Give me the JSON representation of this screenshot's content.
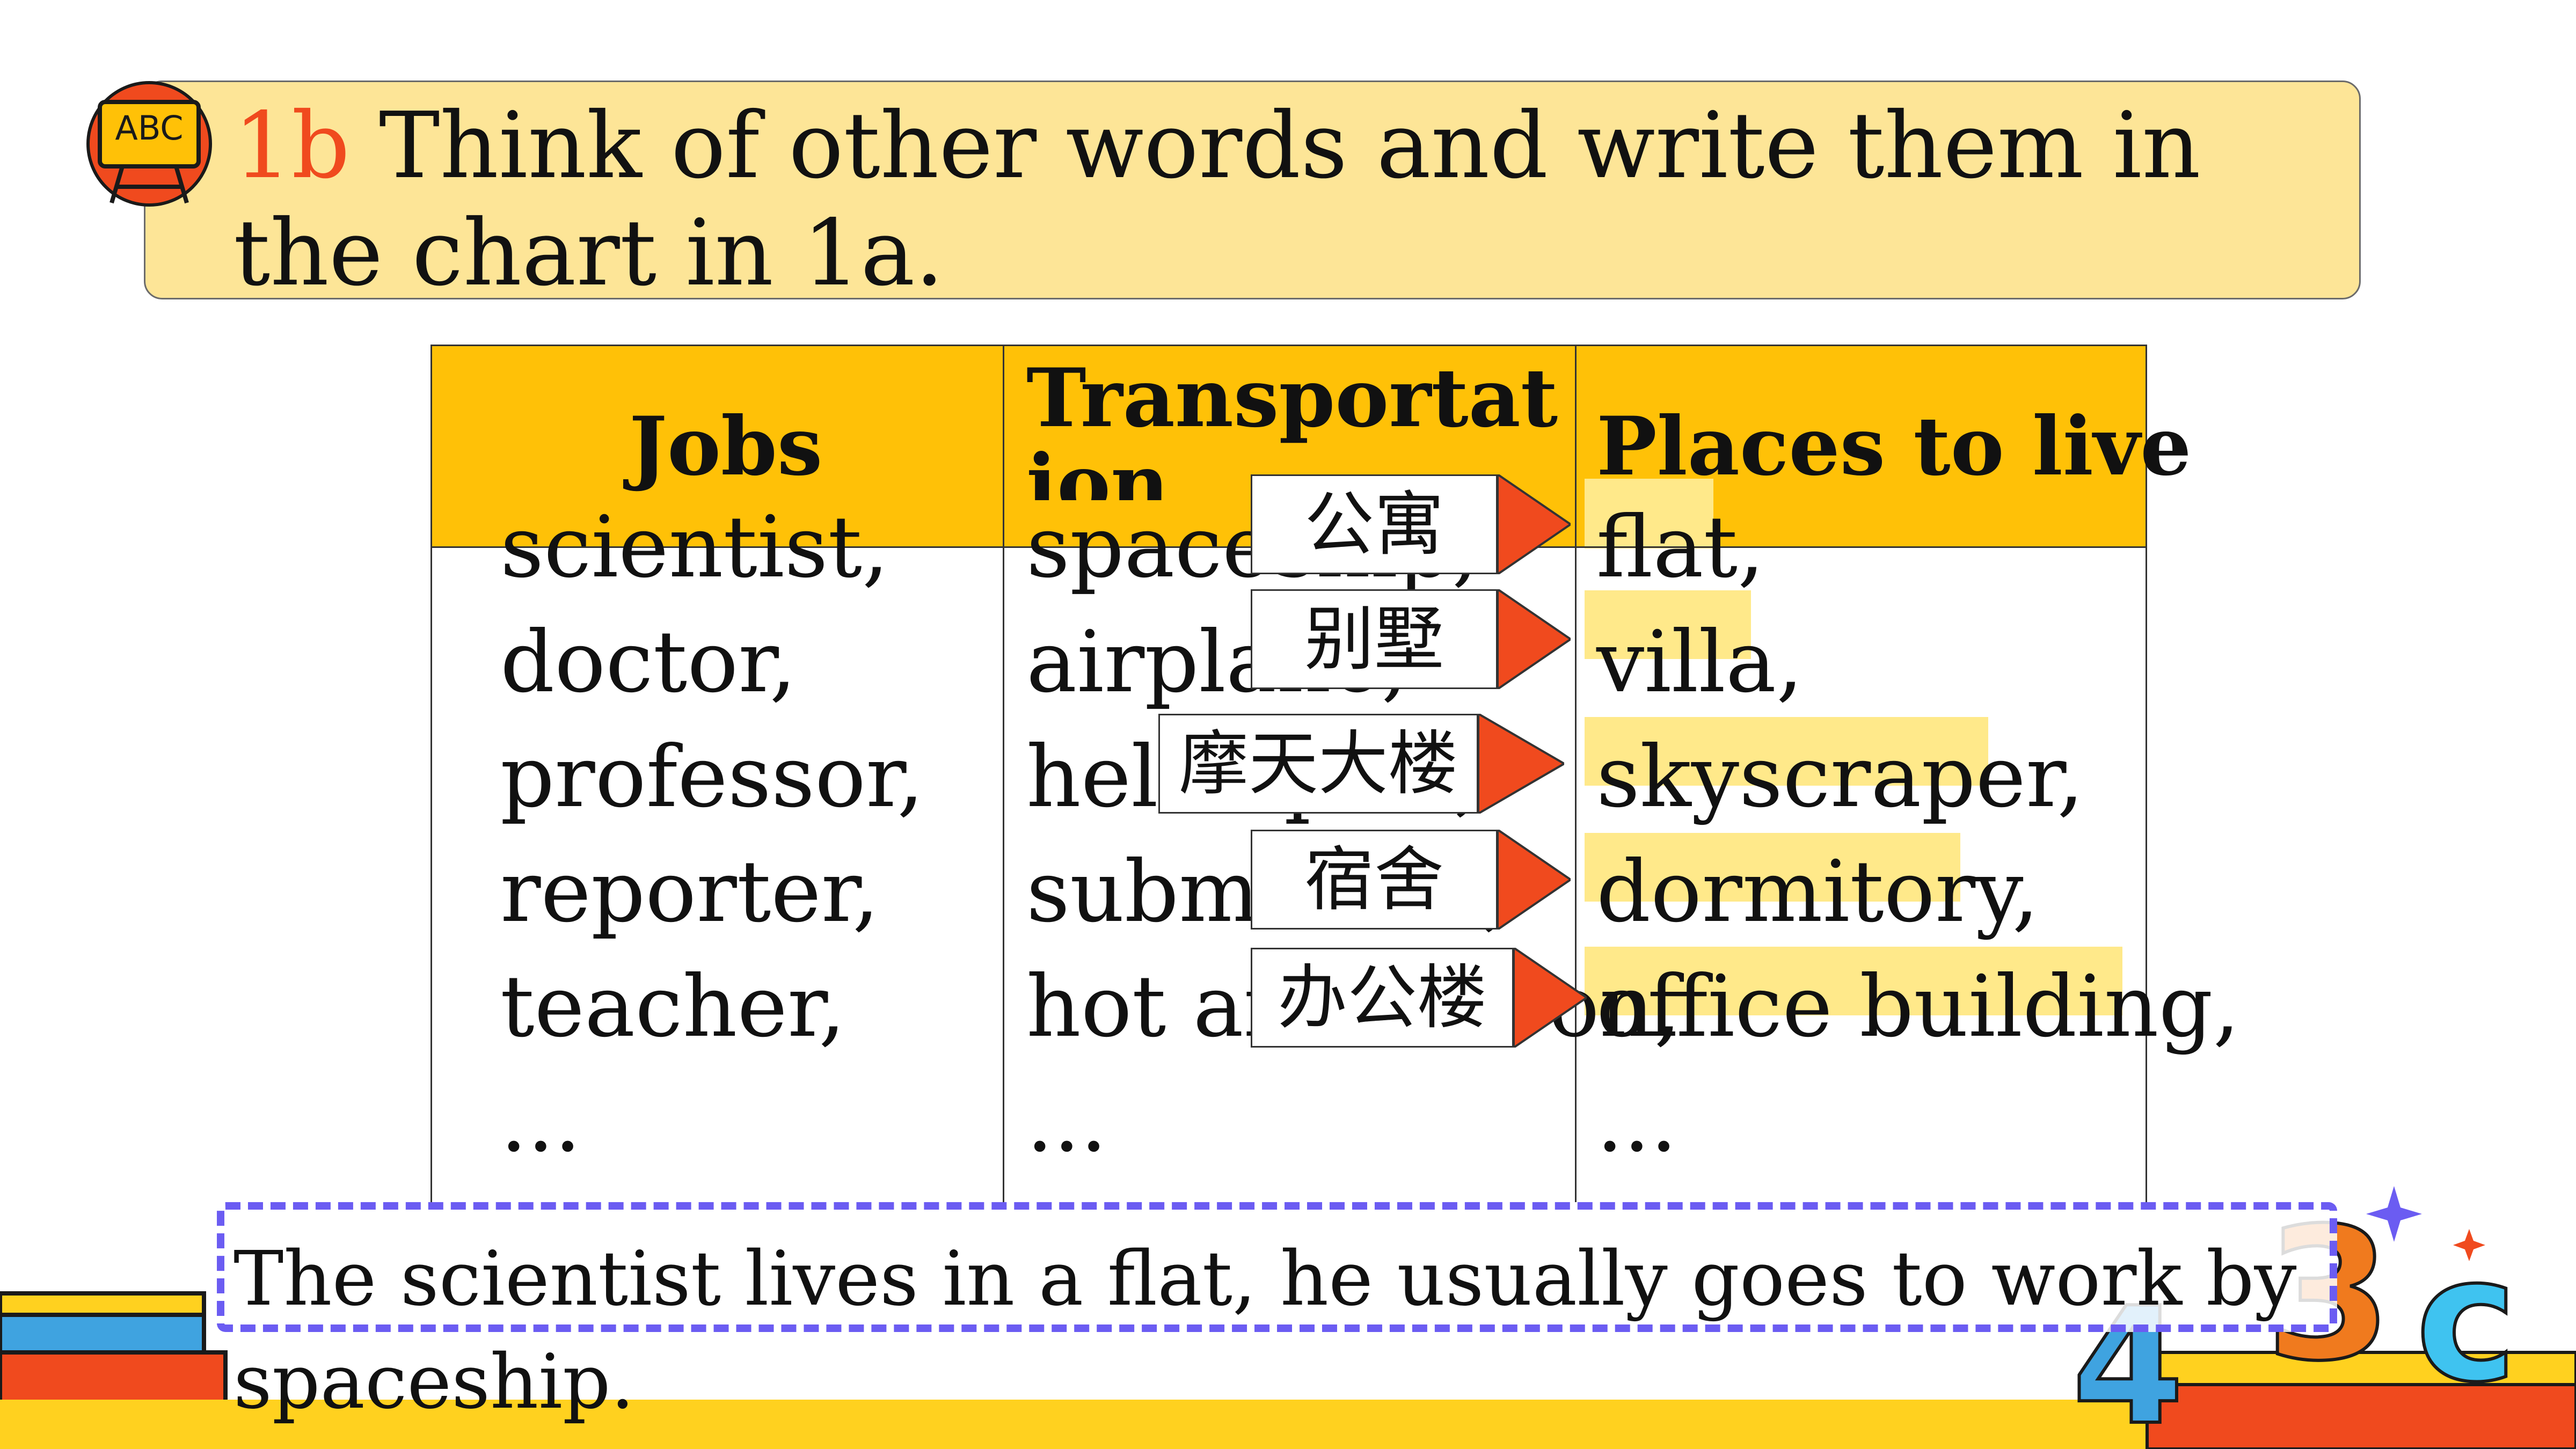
{
  "title": {
    "number": "1b",
    "text": " Think of other words and write them in the chart in 1a."
  },
  "badge": {
    "text": "ABC"
  },
  "table": {
    "headers": [
      "Jobs",
      "Transportation",
      "Places to live"
    ],
    "columns": [
      [
        "scientist,",
        "doctor,",
        "professor,",
        "reporter,",
        "teacher,",
        "..."
      ],
      [
        "spaceship,",
        "airplane,",
        "helicopter,",
        "submarine,",
        "hot air balloon,",
        "..."
      ],
      [
        "flat,",
        "villa,",
        "skyscraper,",
        "dormitory,",
        "office building,",
        "..."
      ]
    ]
  },
  "tags": [
    "公寓",
    "别墅",
    "摩天大楼",
    "宿舍",
    "办公楼"
  ],
  "sentence": "The scientist lives in a flat, he usually goes to work by spaceship.",
  "colors": {
    "accent": "#F04A1E",
    "header": "#FFC107",
    "banner": "#FDE597",
    "highlight": "#FFE98A",
    "dashed": "#6B5CF2"
  }
}
